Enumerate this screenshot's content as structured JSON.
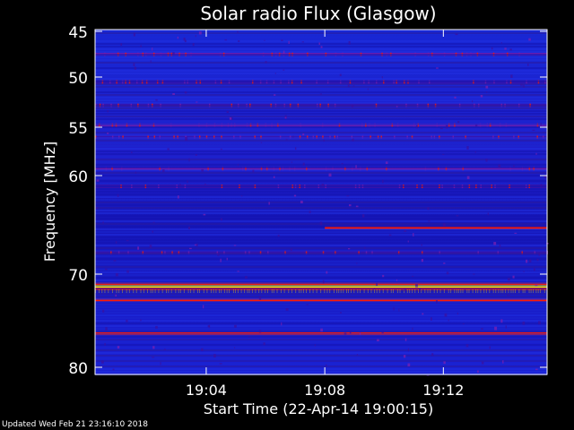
{
  "chart_data": {
    "type": "heatmap",
    "title": "Solar radio Flux (Glasgow)",
    "xlabel": "Start Time (22-Apr-14 19:00:15)",
    "ylabel": "Frequency [MHz]",
    "x_ticks": [
      "19:04",
      "19:08",
      "19:12"
    ],
    "y_ticks": [
      45,
      50,
      55,
      60,
      70,
      80
    ],
    "ylim": [
      45,
      80
    ],
    "xlim": [
      "19:00:15",
      "19:15:30"
    ],
    "colors": {
      "background": "#000000",
      "field": "#1a24c9",
      "mid": "#3b12a8",
      "weak": "#7a1ca8",
      "strong": "#ff1a00",
      "peak": "#ffff00"
    },
    "series": [
      {
        "name": "",
        "freq_mhz": 47.5,
        "start": "19:00:15",
        "end": "19:15:30",
        "intensity": 0.35
      },
      {
        "name": "",
        "freq_mhz": 50.5,
        "start": "19:00:15",
        "end": "19:15:30",
        "intensity": 0.22
      },
      {
        "name": "",
        "freq_mhz": 52.8,
        "start": "19:00:15",
        "end": "19:15:30",
        "intensity": 0.3
      },
      {
        "name": "",
        "freq_mhz": 54.8,
        "start": "19:00:15",
        "end": "19:15:30",
        "intensity": 0.4
      },
      {
        "name": "",
        "freq_mhz": 56.0,
        "start": "19:00:15",
        "end": "19:15:30",
        "intensity": 0.28
      },
      {
        "name": "",
        "freq_mhz": 59.3,
        "start": "19:00:15",
        "end": "19:15:30",
        "intensity": 0.45
      },
      {
        "name": "",
        "freq_mhz": 61.1,
        "start": "19:00:15",
        "end": "19:15:30",
        "intensity": 0.2
      },
      {
        "name": "",
        "freq_mhz": 65.3,
        "start": "19:08:00",
        "end": "19:15:30",
        "intensity": 0.85
      },
      {
        "name": "",
        "freq_mhz": 67.8,
        "start": "19:00:15",
        "end": "19:15:30",
        "intensity": 0.32
      },
      {
        "name": "",
        "freq_mhz": 71.3,
        "start": "19:00:15",
        "end": "19:15:30",
        "intensity": 1.0
      },
      {
        "name": "",
        "freq_mhz": 72.8,
        "start": "19:00:15",
        "end": "19:15:30",
        "intensity": 0.62
      },
      {
        "name": "",
        "freq_mhz": 76.4,
        "start": "19:00:15",
        "end": "19:15:30",
        "intensity": 0.82
      }
    ]
  },
  "footer": {
    "updated": "Updated Wed Feb 21 23:16:10 2018"
  }
}
